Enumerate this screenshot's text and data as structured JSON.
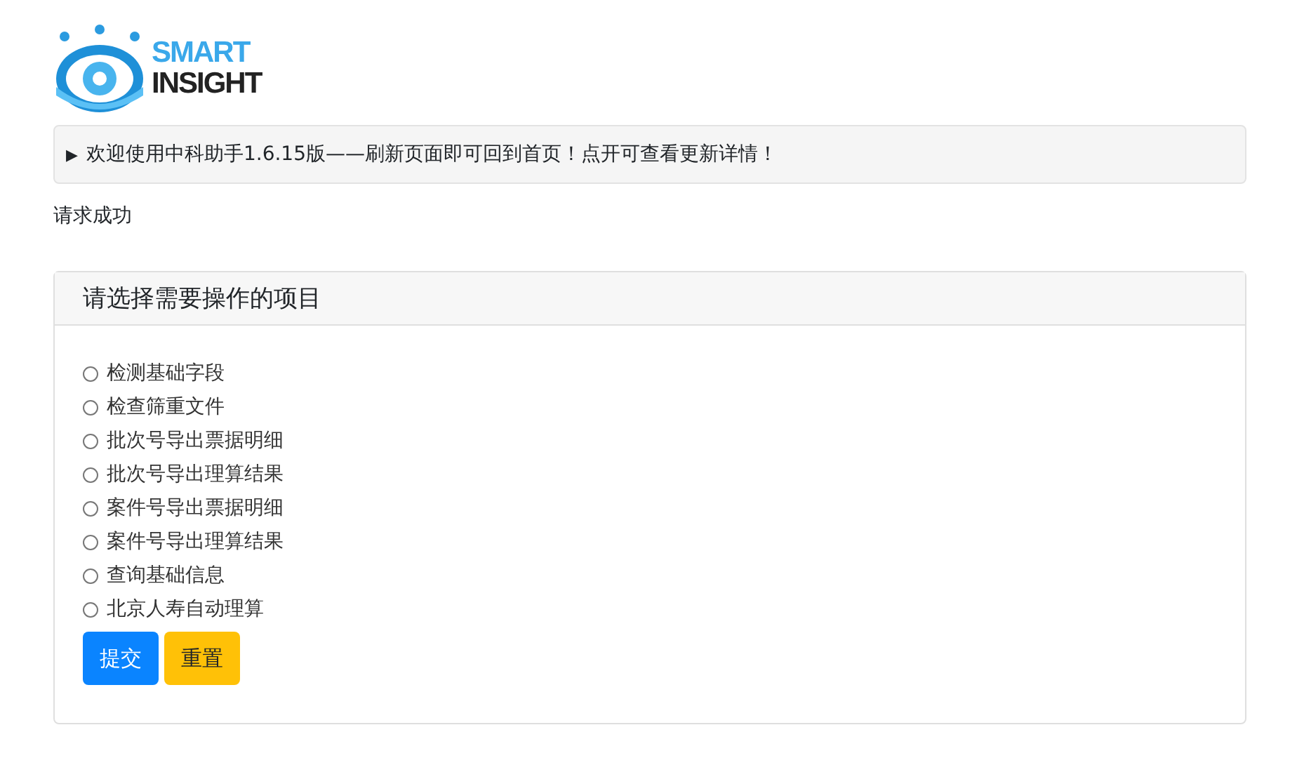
{
  "logo": {
    "line_1": "SMART",
    "line_2": "INSIGHT"
  },
  "notice": {
    "marker": "▶",
    "text": "欢迎使用中科助手1.6.15版——刷新页面即可回到首页！点开可查看更新详情！",
    "expanded": false
  },
  "status": "请求成功",
  "card": {
    "title": "请选择需要操作的项目",
    "options": [
      {
        "label": "检测基础字段",
        "selected": false
      },
      {
        "label": "检查筛重文件",
        "selected": false
      },
      {
        "label": "批次号导出票据明细",
        "selected": false
      },
      {
        "label": "批次号导出理算结果",
        "selected": false
      },
      {
        "label": "案件号导出票据明细",
        "selected": false
      },
      {
        "label": "案件号导出理算结果",
        "selected": false
      },
      {
        "label": "查询基础信息",
        "selected": false
      },
      {
        "label": "北京人寿自动理算",
        "selected": false
      }
    ],
    "buttons": [
      {
        "label": "提交",
        "kind": "primary"
      },
      {
        "label": "重置",
        "kind": "warning"
      }
    ]
  }
}
